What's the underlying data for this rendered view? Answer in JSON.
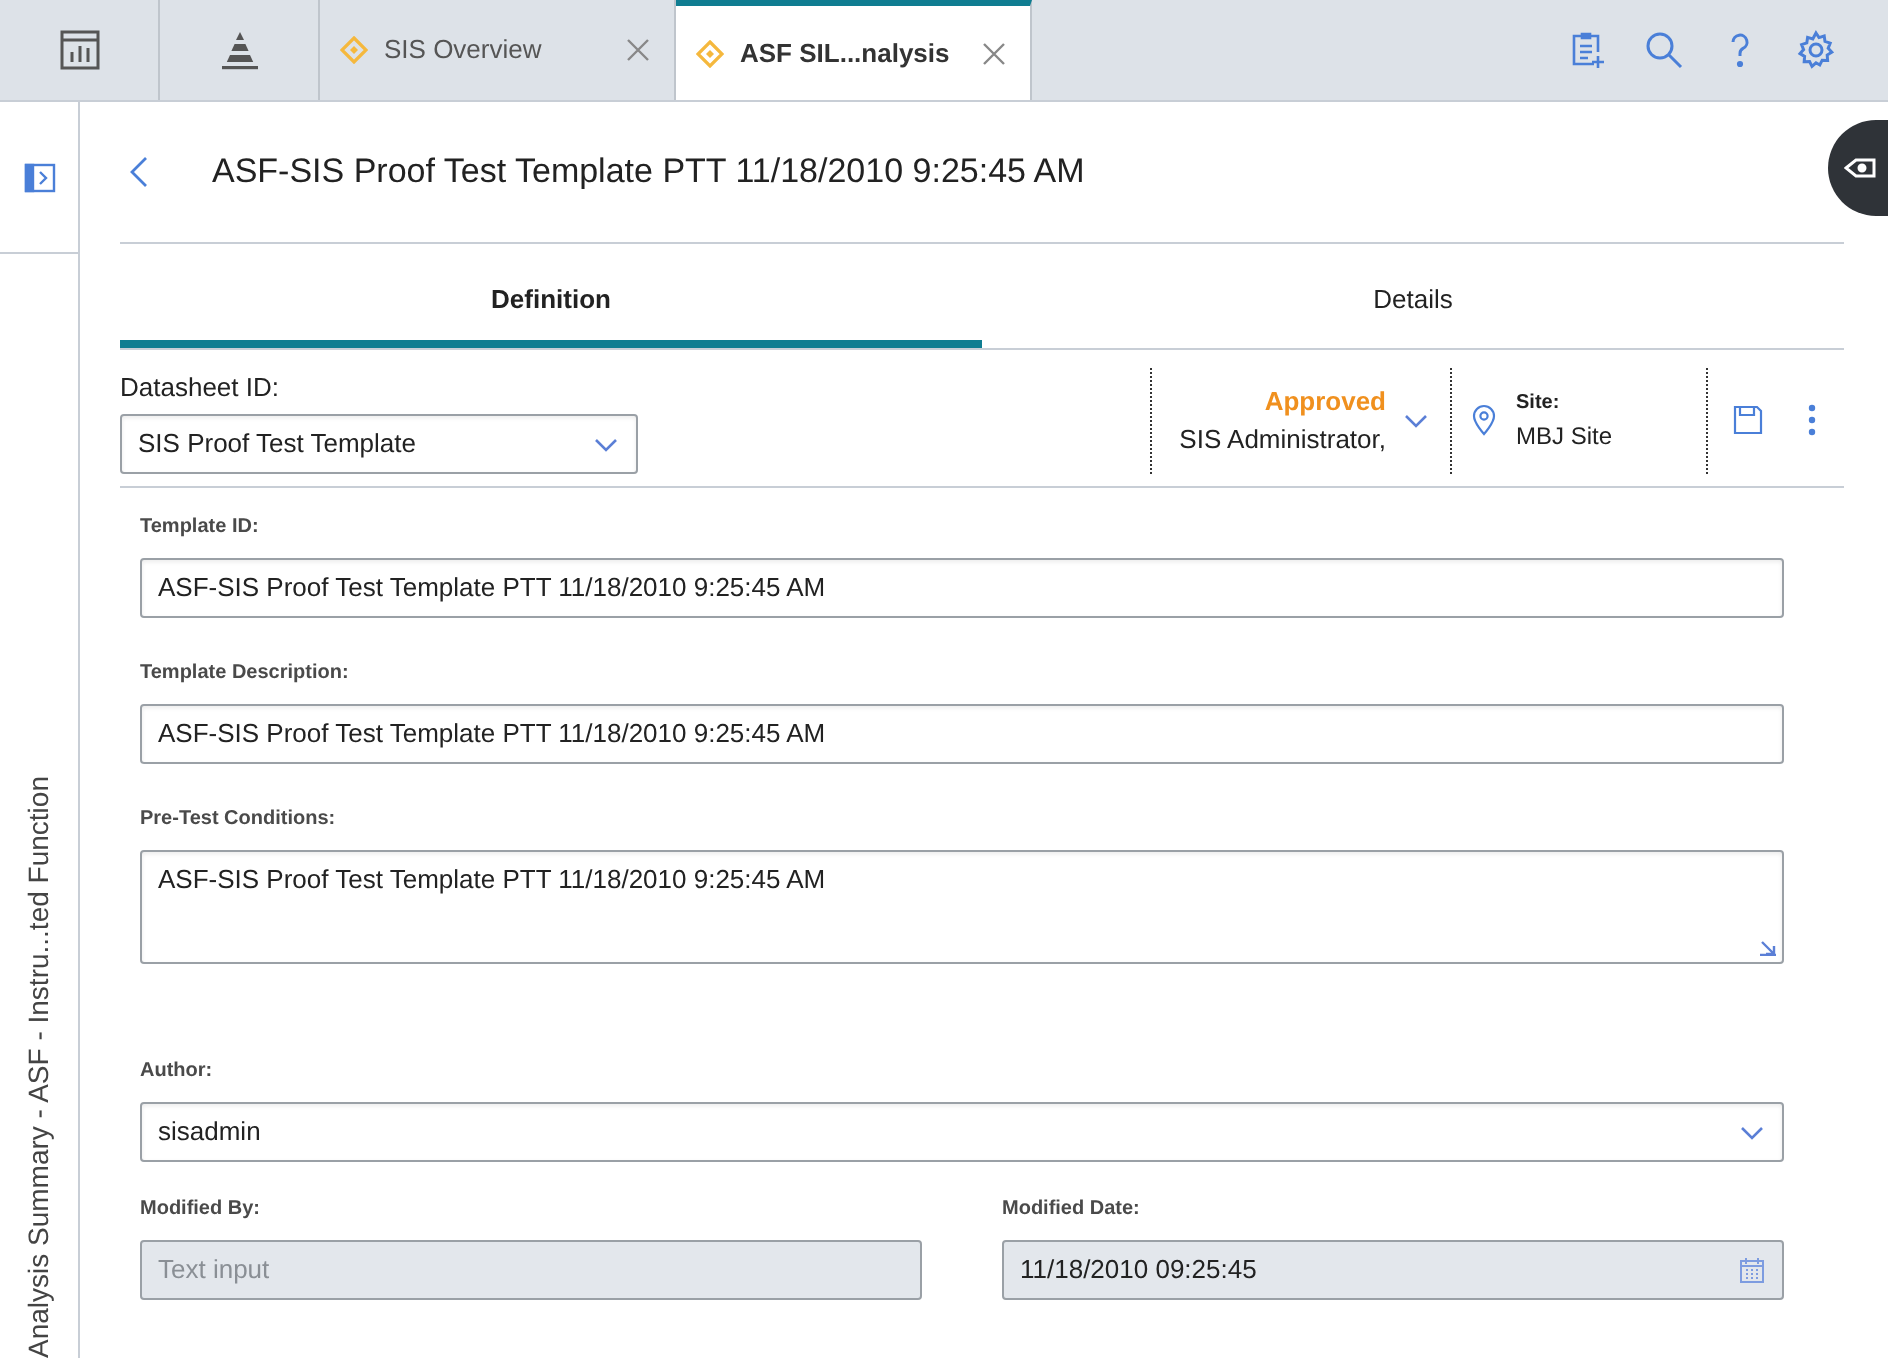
{
  "document_tabs": [
    {
      "label": "SIS Overview",
      "selected": false
    },
    {
      "label": "ASF SIL...nalysis",
      "selected": true
    }
  ],
  "sidebar": {
    "caption": "Analysis Summary - ASF - Instru...ted Function"
  },
  "header": {
    "title": "ASF-SIS Proof Test Template PTT 11/18/2010 9:25:45 AM"
  },
  "tabs": [
    {
      "label": "Definition",
      "selected": true
    },
    {
      "label": "Details",
      "selected": false
    }
  ],
  "datasheet": {
    "label": "Datasheet ID:",
    "value": "SIS Proof Test Template"
  },
  "state": {
    "status": "Approved",
    "user": "SIS Administrator,"
  },
  "site": {
    "label": "Site:",
    "value": "MBJ Site"
  },
  "fields": [
    {
      "kind": "text",
      "label": "Template ID:",
      "value": "ASF-SIS Proof Test Template PTT 11/18/2010 9:25:45 AM",
      "disabled": false
    },
    {
      "kind": "text",
      "label": "Template Description:",
      "value": "ASF-SIS Proof Test Template PTT 11/18/2010 9:25:45 AM",
      "disabled": false
    },
    {
      "kind": "textarea",
      "label": "Pre-Test Conditions:",
      "value": "ASF-SIS Proof Test Template PTT 11/18/2010 9:25:45 AM",
      "disabled": false
    },
    {
      "kind": "select",
      "label": "Author:",
      "value": "sisadmin",
      "disabled": false
    }
  ],
  "row_fields": [
    {
      "kind": "text",
      "label": "Modified By:",
      "placeholder": "Text input",
      "disabled": true
    },
    {
      "kind": "date",
      "label": "Modified Date:",
      "value": "11/18/2010 09:25:45",
      "disabled": true
    }
  ]
}
